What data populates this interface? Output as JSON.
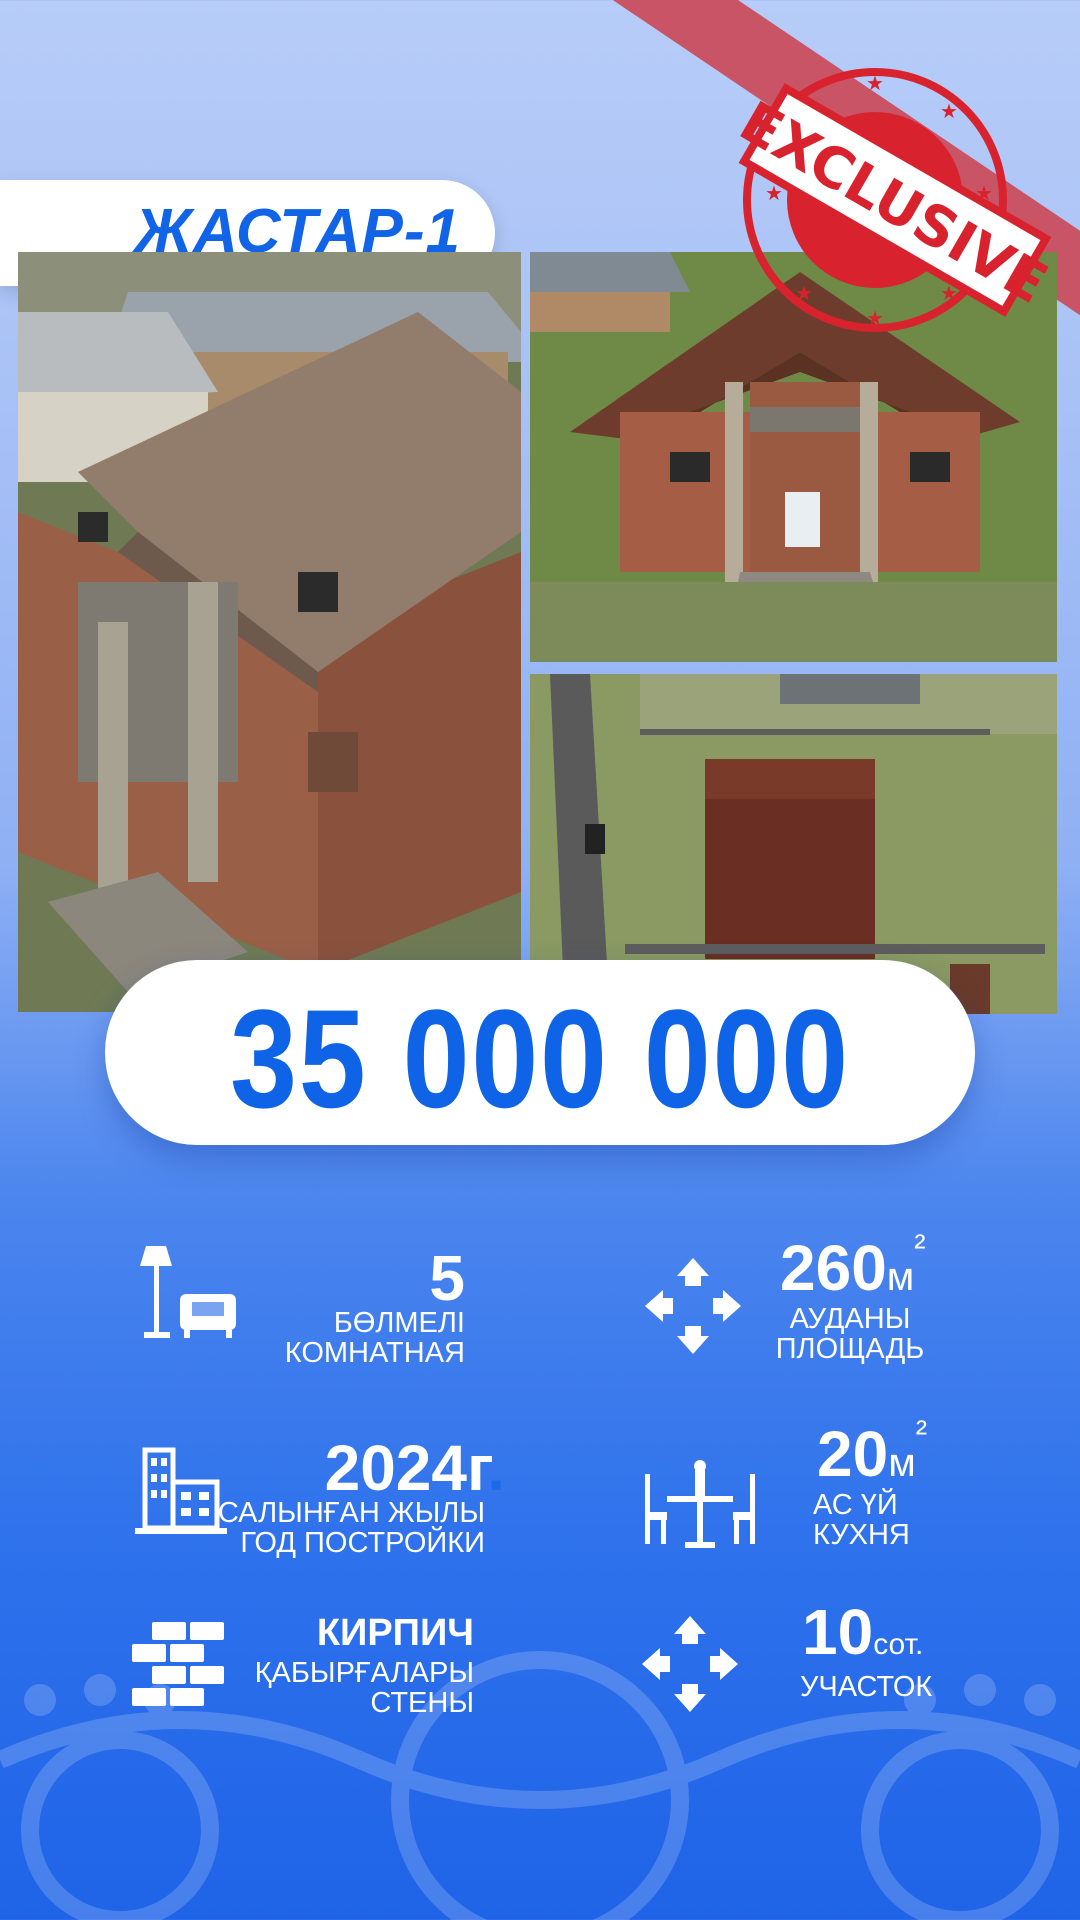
{
  "title": "ЖАСТАР-1",
  "stamp_text": "EXCLUSIVE",
  "price": "35 000 000",
  "colors": {
    "accent": "#1264e6",
    "ribbon": "#c95466",
    "stamp": "#d8232e"
  },
  "features": {
    "rooms": {
      "icon": "lamp-sofa-icon",
      "value": "5",
      "label_kz": "БӨЛМЕЛІ",
      "label_ru": "КОМНАТНАЯ"
    },
    "area": {
      "icon": "expand-arrows-icon",
      "value": "260",
      "unit": "м",
      "sup": "²",
      "label_kz": "АУДАНЫ",
      "label_ru": "ПЛОЩАДЬ"
    },
    "year": {
      "icon": "buildings-icon",
      "value": "2024г",
      "dot": ".",
      "label_kz": "САЛЫНҒАН ЖЫЛЫ",
      "label_ru": "ГОД ПОСТРОЙКИ"
    },
    "kitchen": {
      "icon": "dining-table-icon",
      "value": "20",
      "unit": "м",
      "sup": "²",
      "label_kz": "АС ҮЙ",
      "label_ru": "КУХНЯ"
    },
    "walls": {
      "icon": "bricks-icon",
      "value": "КИРПИЧ",
      "label_kz": "ҚАБЫРҒАЛАРЫ",
      "label_ru": "СТЕНЫ"
    },
    "plot": {
      "icon": "expand-arrows-icon",
      "value": "10",
      "unit": "сот.",
      "label_ru": "УЧАСТОК"
    }
  }
}
